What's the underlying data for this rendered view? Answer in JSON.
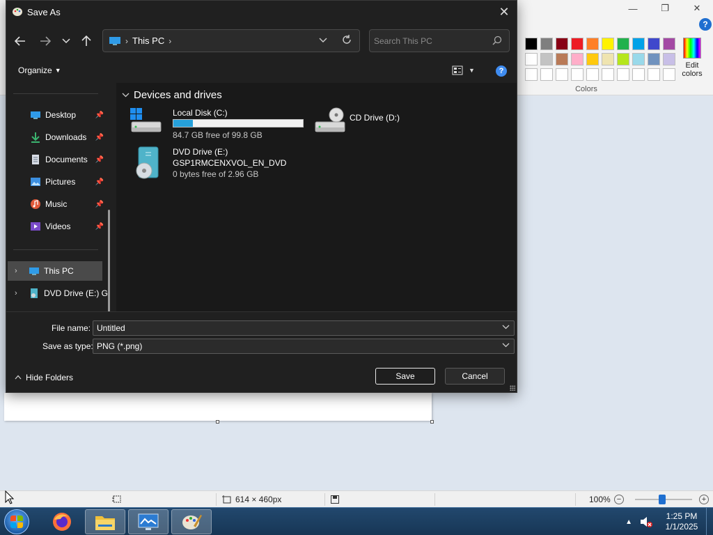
{
  "dialog": {
    "title": "Save As",
    "address": {
      "location": "This PC",
      "separator": "›",
      "trailing_chevron": "›"
    },
    "search": {
      "placeholder": "Search This PC"
    },
    "toolbar": {
      "organize_label": "Organize",
      "help_glyph": "?"
    },
    "nav": {
      "quick_access": [
        {
          "label": "Desktop",
          "icon": "desktop-icon",
          "pinned": true
        },
        {
          "label": "Downloads",
          "icon": "downloads-icon",
          "pinned": true
        },
        {
          "label": "Documents",
          "icon": "documents-icon",
          "pinned": true
        },
        {
          "label": "Pictures",
          "icon": "pictures-icon",
          "pinned": true
        },
        {
          "label": "Music",
          "icon": "music-icon",
          "pinned": true
        },
        {
          "label": "Videos",
          "icon": "videos-icon",
          "pinned": true
        }
      ],
      "tree": [
        {
          "label": "This PC",
          "icon": "this-pc-icon",
          "selected": true
        },
        {
          "label": "DVD Drive (E:) G",
          "icon": "dvd-drive-icon",
          "selected": false
        }
      ]
    },
    "content": {
      "group_header": "Devices and drives",
      "drives": [
        {
          "name": "Local Disk (C:)",
          "subtitle": "84.7 GB free of 99.8 GB",
          "used_fraction": 0.15,
          "icon": "local-disk-icon"
        },
        {
          "name": "CD Drive (D:)",
          "icon": "cd-drive-icon"
        },
        {
          "name": "DVD Drive (E:)",
          "volume": "GSP1RMCENXVOL_EN_DVD",
          "subtitle": "0 bytes free of 2.96 GB",
          "icon": "dvd-drive-icon"
        }
      ]
    },
    "file_name": {
      "label": "File name:",
      "value": "Untitled"
    },
    "save_as_type": {
      "label": "Save as type:",
      "value": "PNG (*.png)"
    },
    "hide_folders_label": "Hide Folders",
    "save_label": "Save",
    "cancel_label": "Cancel"
  },
  "paint": {
    "colors_label": "Colors",
    "edit_colors_label": "Edit colors",
    "palette": [
      "#000000",
      "#7f7f7f",
      "#880015",
      "#ed1c24",
      "#ff7f27",
      "#fff200",
      "#22b14c",
      "#00a2e8",
      "#3f48cc",
      "#a349a4",
      "#ffffff",
      "#c3c3c3",
      "#b97a57",
      "#ffaec9",
      "#ffc90e",
      "#efe4b0",
      "#b5e61d",
      "#99d9ea",
      "#7092be",
      "#c8bfe7",
      "#ffffff",
      "#ffffff",
      "#ffffff",
      "#ffffff",
      "#ffffff",
      "#ffffff",
      "#ffffff",
      "#ffffff",
      "#ffffff",
      "#ffffff"
    ],
    "status": {
      "canvas_size": "614 × 460px",
      "zoom": "100%",
      "zoom_out": "−",
      "zoom_in": "+"
    }
  },
  "taskbar": {
    "apps": [
      "firefox-icon",
      "file-explorer-icon",
      "monitor-app-icon",
      "paint-icon"
    ],
    "time": "1:25 PM",
    "date": "1/1/2025"
  },
  "accent": "#26a0da"
}
